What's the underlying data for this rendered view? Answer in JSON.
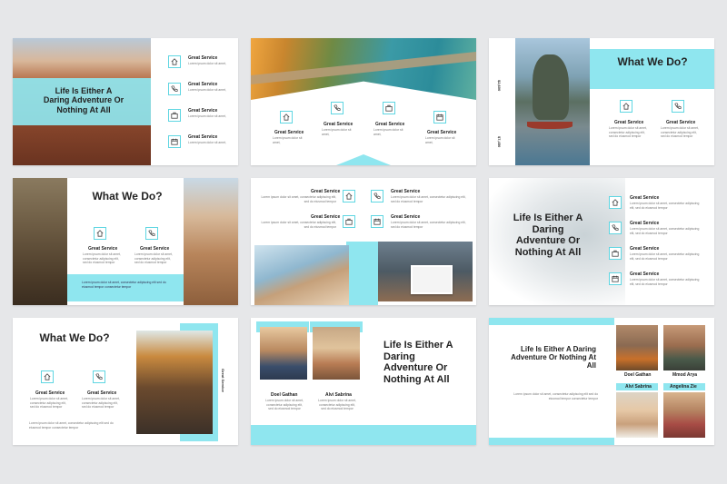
{
  "texts": {
    "adventure_title": "Life Is Either A Daring Adventure Or Nothing At All",
    "what_we_do": "What We Do?",
    "great_service": "Great Service",
    "lorem_short": "Lorem ipsum dolor sit amet,",
    "lorem_short2": "cons adipiscing elit a",
    "lorem_long": "Lorem ipsum dolor sit amet, consectetur adipiscing elit, sed do eiusmod tempor",
    "lorem_long2": "Lorem ipsum dolor sit amet, consectetur adipiscing elit sed do eiusmod tempor consectetur tempor",
    "vertical_price_1": "$2,600",
    "vertical_price_2": "$7,450",
    "vertical_service": "Great Service"
  },
  "team": {
    "names": [
      "Doel Gathan",
      "Alvi Sabrina",
      "Mmod Arya",
      "Angelina Zie"
    ]
  },
  "colors": {
    "accent": "#8fe6ef",
    "icon_border": "#5fd6e2",
    "background": "#e6e7e9"
  },
  "icons": [
    "home-icon",
    "phone-icon",
    "briefcase-icon",
    "calendar-icon"
  ]
}
